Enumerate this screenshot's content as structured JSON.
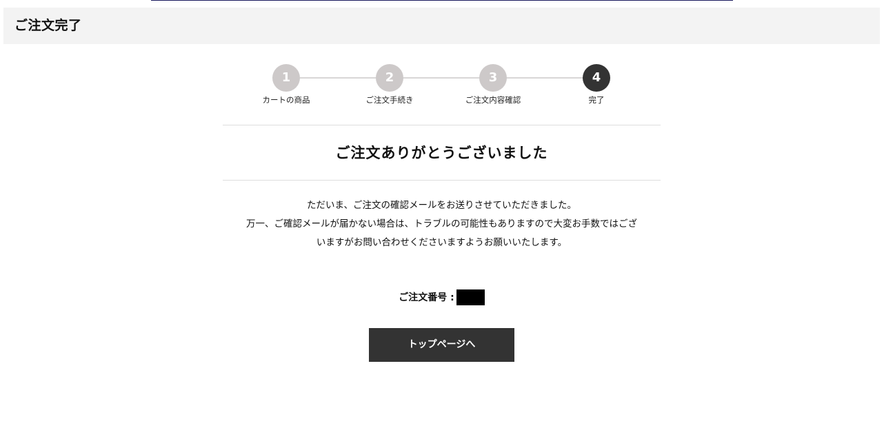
{
  "header": {
    "title": "ご注文完了"
  },
  "stepper": {
    "steps": [
      {
        "number": "1",
        "label": "カートの商品"
      },
      {
        "number": "2",
        "label": "ご注文手続き"
      },
      {
        "number": "3",
        "label": "ご注文内容確認"
      },
      {
        "number": "4",
        "label": "完了"
      }
    ],
    "active_step": 4
  },
  "main": {
    "title": "ご注文ありがとうございました",
    "message_lines": [
      "ただいま、ご注文の確認メールをお送りさせていただきました。",
      "万一、ご確認メールが届かない場合は、トラブルの可能性もありますので大変お手数ではござ",
      "いますがお問い合わせくださいますようお願いいたします。"
    ],
    "order_number_label": "ご注文番号 :",
    "order_number_value": "",
    "button_label": "トップページへ"
  },
  "colors": {
    "header_bg": "#f3f3f3",
    "step_inactive": "#cdc9c9",
    "step_active": "#333333",
    "button_bg": "#333333"
  }
}
